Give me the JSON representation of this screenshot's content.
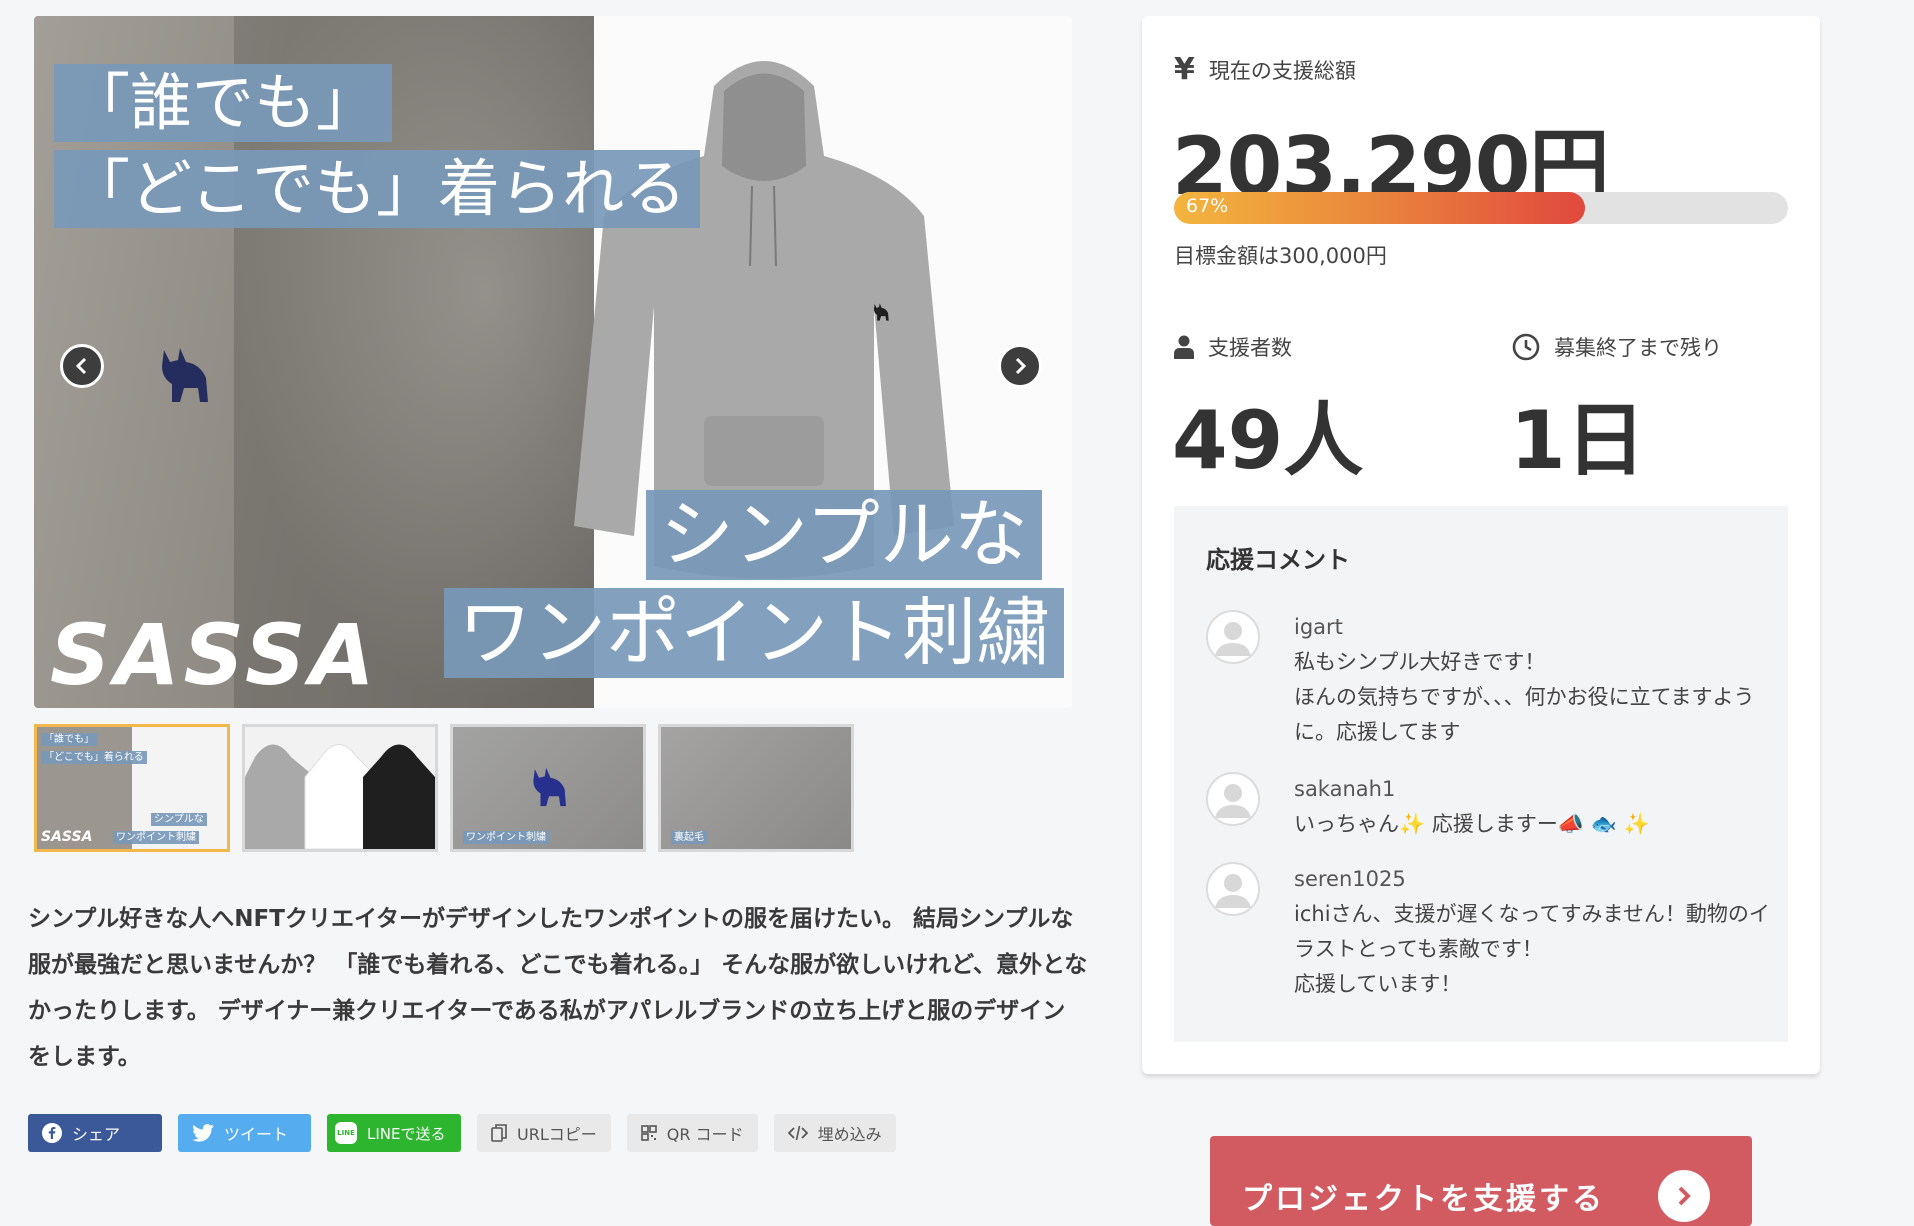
{
  "slideshow": {
    "caption_line1": "「誰でも」",
    "caption_line2": "「どこでも」着られる",
    "caption_line3": "シンプルな",
    "caption_line4": "ワンポイント刺繍",
    "logo_text": "SASSA",
    "prev_icon": "chevron-left-icon",
    "next_icon": "chevron-right-icon",
    "thumbnails": [
      {
        "tag1": "「誰でも」",
        "tag2": "「どこでも」着られる",
        "tag3": "シンプルな",
        "tag4": "ワンポイント刺繍",
        "logo": "SASSA"
      },
      {},
      {
        "tag1": "ワンポイント刺繍"
      },
      {
        "tag1": "裏起毛"
      }
    ]
  },
  "description": "シンプル好きな人へNFTクリエイターがデザインしたワンポイントの服を届けたい。 結局シンプルな服が最強だと思いませんか？ 「誰でも着れる、どこでも着れる。」 そんな服が欲しいけれど、意外となかったりします。 デザイナー兼クリエイターである私がアパレルブランドの立ち上げと服のデザインをします。",
  "share": {
    "facebook": "シェア",
    "twitter": "ツイート",
    "line": "LINEで送る",
    "line_icon_text": "LINE",
    "url_copy": "URLコピー",
    "qr_code": "QR コード",
    "embed": "埋め込み"
  },
  "funding": {
    "total_label": "現在の支援総額",
    "total_amount": "203,290円",
    "progress_percent": 67,
    "progress_text": "67%",
    "goal_text": "目標金額は300,000円",
    "backers_label": "支援者数",
    "backers_value": "49人",
    "remaining_label": "募集終了まで残り",
    "remaining_value": "1日"
  },
  "comments": {
    "title": "応援コメント",
    "items": [
      {
        "user": "igart",
        "text": "私もシンプル大好きです！\nほんの気持ちですが、、、何かお役に立てますように。応援してます"
      },
      {
        "user": "sakanah1",
        "text": "いっちゃん✨ 応援しますー📣 🐟 ✨"
      },
      {
        "user": "seren1025",
        "text": "ichiさん、支援が遅くなってすみません！動物のイラストとっても素敵です！\n応援しています！"
      }
    ]
  },
  "support_button": "プロジェクトを支援する",
  "colors": {
    "accent_button": "#d25b62",
    "progress_start": "#f3b53e",
    "progress_end": "#e1483e",
    "thumb_active": "#f2b84b",
    "caption_blue": "#7899b9"
  }
}
